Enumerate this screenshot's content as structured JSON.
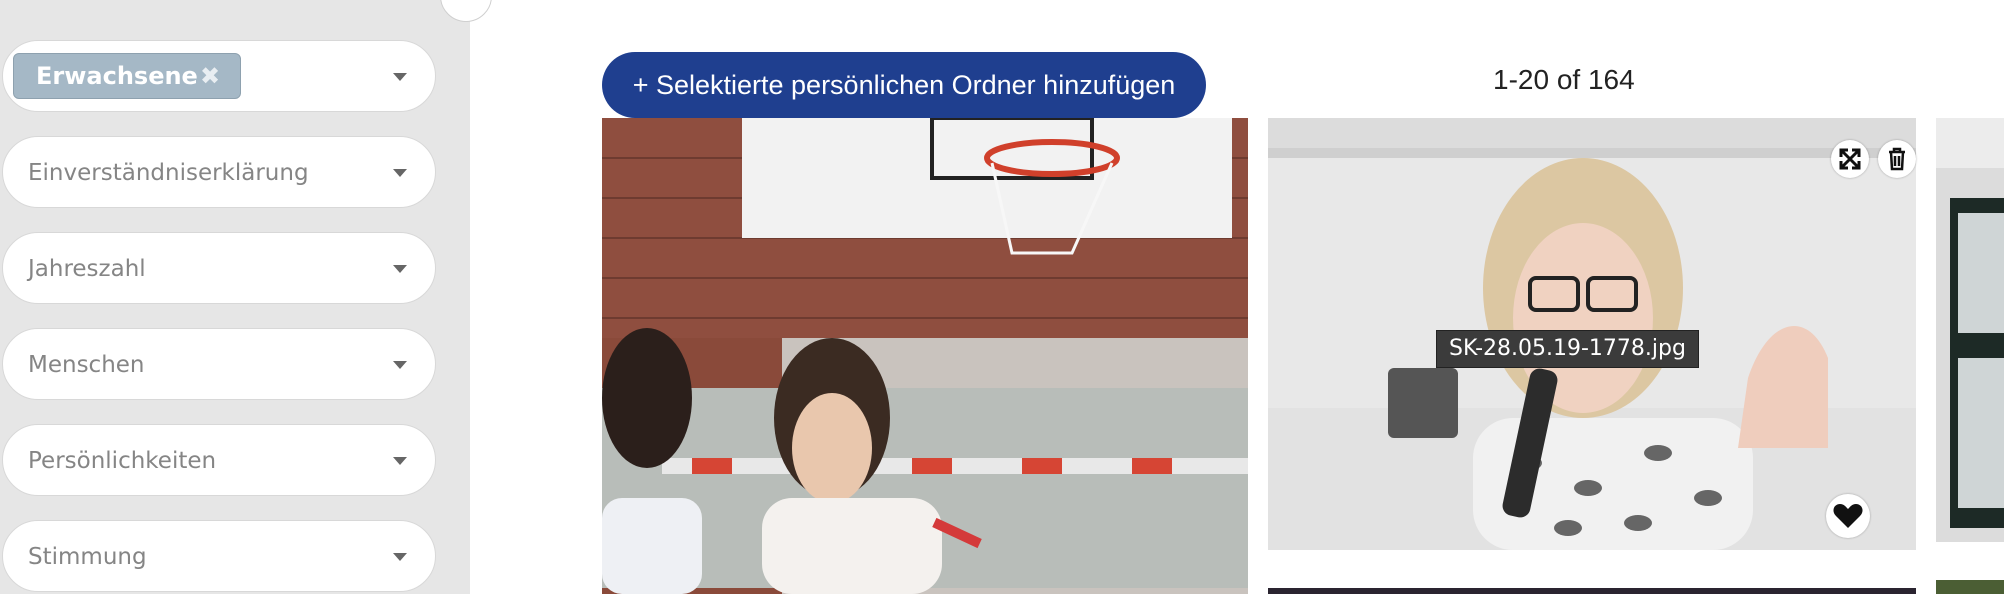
{
  "sidebar": {
    "active_filter_tag": "Erwachsene",
    "active_filter_remove_symbol": "✖",
    "filters": [
      {
        "label": "Einverständniserklärung"
      },
      {
        "label": "Jahreszahl"
      },
      {
        "label": "Menschen"
      },
      {
        "label": "Persönlichkeiten"
      },
      {
        "label": "Stimmung"
      }
    ]
  },
  "toolbar": {
    "add_to_folder_label": "+ Selektierte persönlichen Ordner hinzufügen",
    "pagination_text": "1-20 of 164"
  },
  "gallery": {
    "hovered_filename": "SK-28.05.19-1778.jpg",
    "icons": [
      "expand-icon",
      "trash-icon",
      "heart-icon",
      "chevron-down-icon"
    ]
  },
  "colors": {
    "primary_button": "#1f3f8f",
    "sidebar_bg": "#e6e6e6",
    "tag_bg": "#a5b8c6"
  }
}
